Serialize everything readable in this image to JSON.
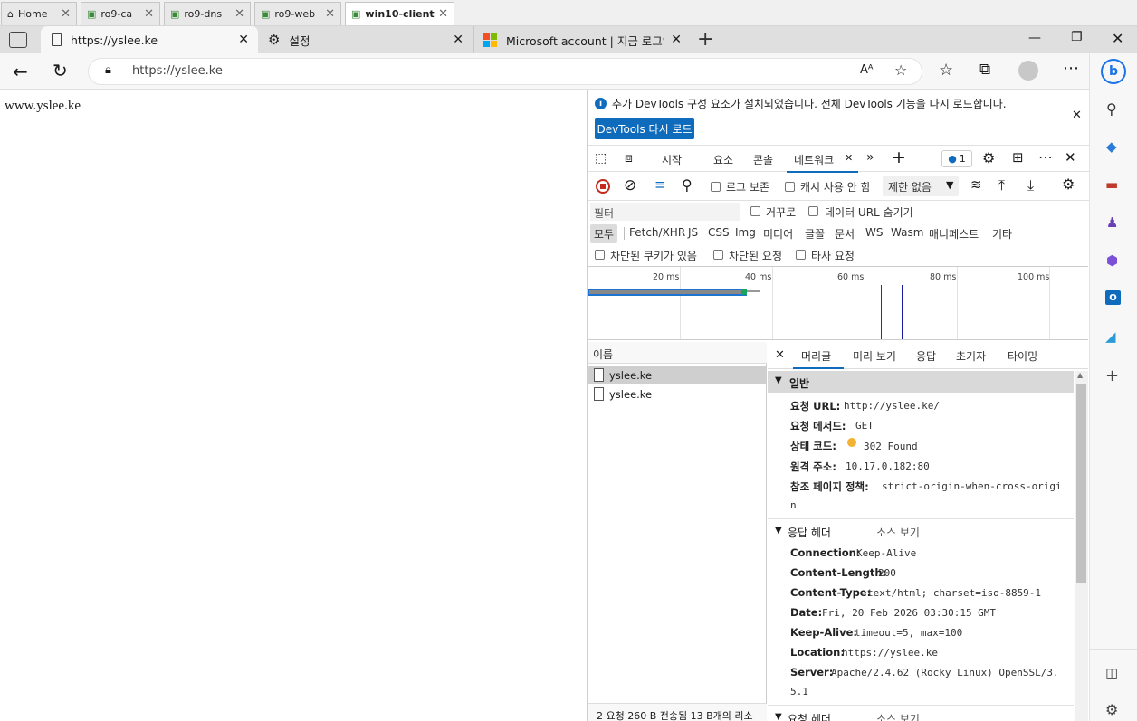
{
  "vm_tabs": [
    {
      "label": "Home",
      "icon": "home-icon"
    },
    {
      "label": "ro9-ca",
      "icon": "vm-icon"
    },
    {
      "label": "ro9-dns",
      "icon": "vm-icon"
    },
    {
      "label": "ro9-web",
      "icon": "vm-icon"
    },
    {
      "label": "win10-client",
      "icon": "vm-icon"
    }
  ],
  "browser_tabs": [
    {
      "label": "https://yslee.ke",
      "icon": "page-icon"
    },
    {
      "label": "설정",
      "icon": "gear-icon"
    },
    {
      "label": "Microsoft account | 지금 로그인",
      "icon": "microsoft-logo-icon"
    }
  ],
  "address": {
    "url": "https://yslee.ke"
  },
  "page": {
    "text": "www.yslee.ke"
  },
  "devtools": {
    "info_bar": {
      "message": "추가 DevTools 구성 요소가 설치되었습니다. 전체 DevTools 기능을 다시 로드합니다.",
      "reload_button": "DevTools 다시 로드"
    },
    "tabs": [
      "시작",
      "요소",
      "콘솔",
      "네트워크"
    ],
    "issues_count": "1",
    "toolbar": {
      "preserve_log": "로그 보존",
      "disable_cache": "캐시 사용 안 함",
      "throttle": "제한 없음"
    },
    "filter": {
      "placeholder": "필터",
      "invert": "거꾸로",
      "hide_data_urls": "데이터 URL 숨기기"
    },
    "type_filters": [
      "모두",
      "Fetch/XHR",
      "JS",
      "CSS",
      "Img",
      "미디어",
      "글꼴",
      "문서",
      "WS",
      "Wasm",
      "매니페스트",
      "기타"
    ],
    "blocked": {
      "blocked_cookies": "차단된 쿠키가 있음",
      "blocked_requests": "차단된 요청",
      "third_party": "타사 요청"
    },
    "timeline_ticks": [
      "20 ms",
      "40 ms",
      "60 ms",
      "80 ms",
      "100 ms"
    ],
    "name_header": "이름",
    "requests": [
      "yslee.ke",
      "yslee.ke"
    ],
    "status_bar": "2 요청  260 B 전송됨  13 B개의 리소",
    "detail_tabs": [
      "머리글",
      "미리 보기",
      "응답",
      "초기자",
      "타이밍"
    ],
    "general": {
      "title": "일반",
      "rows": [
        {
          "k": "요청 URL:",
          "v": "http://yslee.ke/"
        },
        {
          "k": "요청 메서드:",
          "v": "GET"
        },
        {
          "k": "상태 코드:",
          "v": "302 Found"
        },
        {
          "k": "원격 주소:",
          "v": "10.17.0.182:80"
        },
        {
          "k": "참조 페이지 정책:",
          "v": "strict-origin-when-cross-origi",
          "v2": "n"
        }
      ]
    },
    "response_headers": {
      "title": "응답 헤더",
      "view_source": "소스 보기",
      "rows": [
        {
          "k": "Connection:",
          "v": "Keep-Alive"
        },
        {
          "k": "Content-Length:",
          "v": "200"
        },
        {
          "k": "Content-Type:",
          "v": "text/html; charset=iso-8859-1"
        },
        {
          "k": "Date:",
          "v": "Fri, 20 Feb 2026 03:30:15 GMT"
        },
        {
          "k": "Keep-Alive:",
          "v": "timeout=5, max=100"
        },
        {
          "k": "Location:",
          "v": "https://yslee.ke"
        },
        {
          "k": "Server:",
          "v": "Apache/2.4.62 (Rocky Linux) OpenSSL/3.",
          "v2": "5.1"
        }
      ]
    },
    "request_headers": {
      "title": "요청 헤더",
      "view_source": "소스 보기"
    }
  },
  "colors": {
    "accent": "#0f6cbd",
    "status_dot": "#f2b233",
    "timeline_red": "#c00000",
    "timeline_blue": "#1a1aa0"
  }
}
